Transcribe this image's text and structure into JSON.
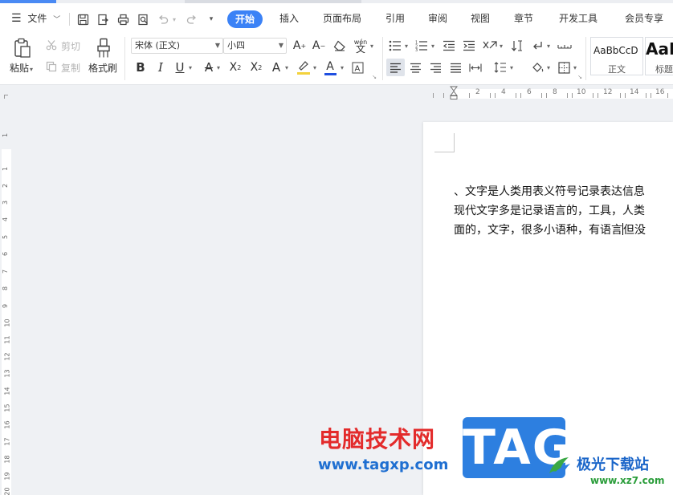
{
  "menu": {
    "file_label": "文件"
  },
  "tabs": [
    {
      "label": "开始",
      "active": true
    },
    {
      "label": "插入"
    },
    {
      "label": "页面布局"
    },
    {
      "label": "引用"
    },
    {
      "label": "审阅"
    },
    {
      "label": "视图"
    },
    {
      "label": "章节"
    },
    {
      "label": "开发工具"
    },
    {
      "label": "会员专享"
    }
  ],
  "clipboard": {
    "paste_label": "粘贴",
    "cut_label": "剪切",
    "copy_label": "复制",
    "format_painter_label": "格式刷"
  },
  "font": {
    "family": "宋体 (正文)",
    "size": "小四",
    "wen_glyph": "wén",
    "a_glyph": "A"
  },
  "styles": {
    "normal_preview": "AaBbCcD",
    "normal_label": "正文",
    "heading_preview": "AaB",
    "heading_label": "标题"
  },
  "ruler": {
    "numbers": [
      "2",
      "4",
      "6",
      "8",
      "10",
      "12",
      "14",
      "16"
    ],
    "vertical_numbers": [
      "1",
      "1",
      "2",
      "3",
      "4",
      "5",
      "6",
      "7",
      "8",
      "9",
      "10",
      "11",
      "12",
      "13",
      "14",
      "15",
      "16",
      "17",
      "18",
      "19",
      "20"
    ]
  },
  "document": {
    "lines": [
      "、文字是人类用表义符号记录表达信息",
      "现代文字多是记录语言的，工具，人类",
      "面的，文字，很多小语种，有语言"
    ],
    "line3_after_cursor": "但没"
  },
  "watermark": {
    "site_name": "电脑技术网",
    "site_url": "www.tagxp.com",
    "logo_text": "TAG",
    "brand_name": "极光下载站",
    "brand_url": "www.xz7.com"
  },
  "colors": {
    "accent": "#3b82f6",
    "font_color_bar": "#1f4fe0",
    "highlight_bar": "#f3d23c"
  }
}
